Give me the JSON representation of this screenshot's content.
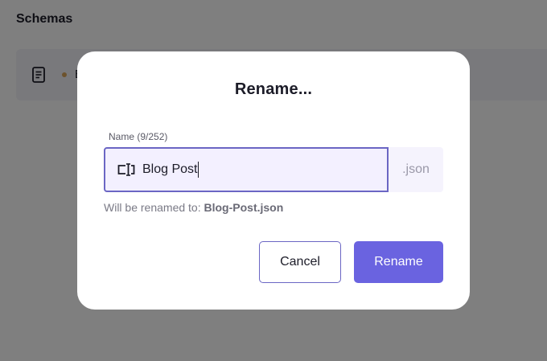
{
  "background": {
    "page_title": "Schemas",
    "row": {
      "label_partial": "B",
      "status_dot_color": "#d9a55b",
      "icon": "document-icon"
    }
  },
  "dialog": {
    "title": "Rename...",
    "field_label": "Name (9/252)",
    "input_value": "Blog Post",
    "input_icon": "rename-cursor-icon",
    "suffix": ".json",
    "helper_prefix": "Will be renamed to:",
    "helper_filename": "Blog-Post.json",
    "cancel_label": "Cancel",
    "rename_label": "Rename"
  },
  "colors": {
    "accent": "#6a63e0",
    "input_border": "#6b66c4",
    "input_bg": "#f3f0ff"
  }
}
